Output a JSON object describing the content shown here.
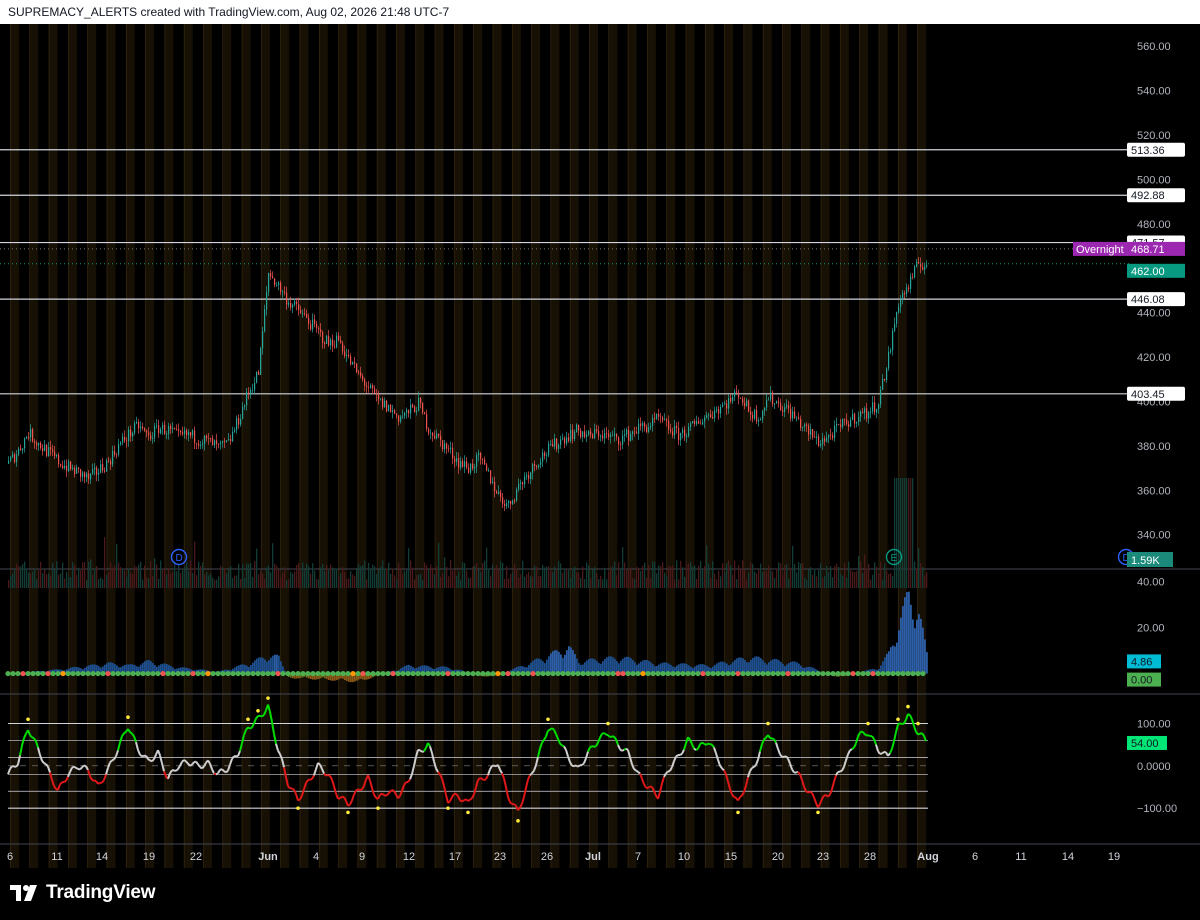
{
  "header": {
    "caption": "SUPREMACY_ALERTS created with TradingView.com, Aug 02, 2026 21:48 UTC-7"
  },
  "footer": {
    "brand": "TradingView"
  },
  "colors": {
    "background": "#000000",
    "up_candle": "#26a69a",
    "down_candle": "#ef5350",
    "level_line": "#d1d4dc",
    "overnight_badge": "#9c27b0",
    "last_price_badge": "#089981",
    "volume_badge": "#1b8a7a",
    "momentum_value_badge": "#00bcd4",
    "momentum_zero_badge": "#4caf50",
    "cci_value_badge": "#00e676",
    "cci_up": "#00e000",
    "cci_down": "#e01818",
    "cci_neutral": "#cfcfcf",
    "dots": "#ffeb3b"
  },
  "chart_data": [
    {
      "type": "candlestick",
      "pane": "price",
      "x_ticks": [
        "6",
        "11",
        "14",
        "19",
        "22",
        "Jun",
        "4",
        "9",
        "12",
        "17",
        "23",
        "26",
        "Jul",
        "7",
        "10",
        "15",
        "20",
        "23",
        "28",
        "Aug",
        "6",
        "11",
        "14",
        "19"
      ],
      "y_ticks": [
        "560.00",
        "540.00",
        "520.00",
        "500.00",
        "480.00",
        "440.00",
        "420.00",
        "400.00",
        "380.00",
        "360.00",
        "340.00"
      ],
      "ylim": [
        325,
        570
      ],
      "path_key": [
        [
          0,
          372
        ],
        [
          1,
          378
        ],
        [
          2,
          386
        ],
        [
          3,
          381
        ],
        [
          4,
          377
        ],
        [
          5,
          373
        ],
        [
          6,
          370
        ],
        [
          7,
          368
        ],
        [
          8,
          365
        ],
        [
          9,
          369
        ],
        [
          10,
          373
        ],
        [
          11,
          380
        ],
        [
          12,
          385
        ],
        [
          13,
          389
        ],
        [
          14,
          384
        ],
        [
          15,
          388
        ],
        [
          16,
          387
        ],
        [
          17,
          384
        ],
        [
          18,
          385
        ],
        [
          19,
          383
        ],
        [
          20,
          382
        ],
        [
          21,
          379
        ],
        [
          22,
          381
        ],
        [
          23,
          392
        ],
        [
          24,
          404
        ],
        [
          25,
          413
        ],
        [
          26,
          458
        ],
        [
          27,
          452
        ],
        [
          28,
          445
        ],
        [
          29,
          441
        ],
        [
          30,
          436
        ],
        [
          31,
          431
        ],
        [
          32,
          426
        ],
        [
          33,
          428
        ],
        [
          34,
          419
        ],
        [
          35,
          412
        ],
        [
          36,
          406
        ],
        [
          37,
          400
        ],
        [
          38,
          397
        ],
        [
          39,
          393
        ],
        [
          40,
          395
        ],
        [
          41,
          399
        ],
        [
          42,
          388
        ],
        [
          43,
          383
        ],
        [
          44,
          378
        ],
        [
          45,
          373
        ],
        [
          46,
          370
        ],
        [
          47,
          374
        ],
        [
          48,
          367
        ],
        [
          49,
          358
        ],
        [
          50,
          353
        ],
        [
          51,
          362
        ],
        [
          52,
          368
        ],
        [
          53,
          374
        ],
        [
          54,
          378
        ],
        [
          55,
          382
        ],
        [
          56,
          385
        ],
        [
          57,
          387
        ],
        [
          58,
          384
        ],
        [
          59,
          386
        ],
        [
          60,
          384
        ],
        [
          61,
          383
        ],
        [
          62,
          385
        ],
        [
          63,
          388
        ],
        [
          64,
          389
        ],
        [
          65,
          392
        ],
        [
          66,
          388
        ],
        [
          67,
          385
        ],
        [
          68,
          387
        ],
        [
          69,
          391
        ],
        [
          70,
          394
        ],
        [
          71,
          397
        ],
        [
          72,
          400
        ],
        [
          73,
          404
        ],
        [
          74,
          396
        ],
        [
          75,
          393
        ],
        [
          76,
          402
        ],
        [
          77,
          399
        ],
        [
          78,
          396
        ],
        [
          79,
          391
        ],
        [
          80,
          386
        ],
        [
          81,
          382
        ],
        [
          82,
          384
        ],
        [
          83,
          388
        ],
        [
          84,
          391
        ],
        [
          85,
          394
        ],
        [
          86,
          395
        ],
        [
          87,
          400
        ],
        [
          88,
          420
        ],
        [
          89,
          445
        ],
        [
          90,
          452
        ],
        [
          91,
          462
        ],
        [
          92,
          462
        ]
      ],
      "levels": [
        {
          "label": "513.36",
          "value": 513.36
        },
        {
          "label": "492.88",
          "value": 492.88
        },
        {
          "label": "471.57",
          "value": 471.57
        },
        {
          "label": "446.08",
          "value": 446.08
        },
        {
          "label": "403.45",
          "value": 403.45
        }
      ],
      "overnight": {
        "label": "Overnight",
        "value_label": "468.71",
        "value": 468.71
      },
      "last_price": {
        "label": "462.00",
        "value": 462.0
      },
      "volume_badge": "1.59K",
      "event_markers": [
        {
          "text": "D",
          "kind": "dividend"
        },
        {
          "text": "E",
          "kind": "earnings"
        },
        {
          "text": "D",
          "kind": "dividend"
        }
      ]
    },
    {
      "type": "histogram",
      "pane": "momentum",
      "y_ticks": [
        "40.00",
        "20.00"
      ],
      "ylim": [
        -8,
        45
      ],
      "current_value": "4.86",
      "zero_label": "0.00",
      "peaks": [
        [
          0,
          0
        ],
        [
          5,
          2
        ],
        [
          10,
          5
        ],
        [
          12,
          4
        ],
        [
          14,
          6
        ],
        [
          17,
          3
        ],
        [
          21,
          1
        ],
        [
          24,
          5
        ],
        [
          26,
          9
        ],
        [
          27,
          8
        ],
        [
          28,
          -2
        ],
        [
          32,
          -3
        ],
        [
          35,
          -4
        ],
        [
          40,
          4
        ],
        [
          44,
          3
        ],
        [
          48,
          -2
        ],
        [
          52,
          5
        ],
        [
          56,
          13
        ],
        [
          57,
          6
        ],
        [
          61,
          8
        ],
        [
          65,
          5
        ],
        [
          70,
          4
        ],
        [
          74,
          8
        ],
        [
          79,
          5
        ],
        [
          83,
          -2
        ],
        [
          87,
          3
        ],
        [
          88,
          10
        ],
        [
          90,
          39
        ],
        [
          91,
          30
        ],
        [
          92,
          5
        ]
      ]
    },
    {
      "type": "line",
      "pane": "cci",
      "y_ticks": [
        "100.00",
        "0.0000",
        "−100.00"
      ],
      "ylim": [
        -180,
        165
      ],
      "current_value": "54.00",
      "band_levels": [
        100,
        60,
        20,
        0,
        -20,
        -60,
        -100
      ],
      "values": [
        [
          0,
          -20
        ],
        [
          1,
          10
        ],
        [
          2,
          90
        ],
        [
          3,
          40
        ],
        [
          4,
          -10
        ],
        [
          5,
          -60
        ],
        [
          6,
          -20
        ],
        [
          7,
          0
        ],
        [
          8,
          -10
        ],
        [
          9,
          -50
        ],
        [
          10,
          -10
        ],
        [
          11,
          40
        ],
        [
          12,
          95
        ],
        [
          13,
          40
        ],
        [
          14,
          10
        ],
        [
          15,
          30
        ],
        [
          16,
          -30
        ],
        [
          17,
          0
        ],
        [
          18,
          10
        ],
        [
          19,
          0
        ],
        [
          20,
          5
        ],
        [
          21,
          -20
        ],
        [
          22,
          -5
        ],
        [
          23,
          30
        ],
        [
          24,
          90
        ],
        [
          25,
          110
        ],
        [
          26,
          140
        ],
        [
          27,
          40
        ],
        [
          28,
          -40
        ],
        [
          29,
          -80
        ],
        [
          30,
          -40
        ],
        [
          31,
          0
        ],
        [
          32,
          -20
        ],
        [
          33,
          -70
        ],
        [
          34,
          -90
        ],
        [
          35,
          -60
        ],
        [
          36,
          -30
        ],
        [
          37,
          -80
        ],
        [
          38,
          -60
        ],
        [
          39,
          -70
        ],
        [
          40,
          -40
        ],
        [
          41,
          30
        ],
        [
          42,
          50
        ],
        [
          43,
          -10
        ],
        [
          44,
          -80
        ],
        [
          45,
          -70
        ],
        [
          46,
          -90
        ],
        [
          47,
          -40
        ],
        [
          48,
          -20
        ],
        [
          49,
          10
        ],
        [
          50,
          -70
        ],
        [
          51,
          -110
        ],
        [
          52,
          -40
        ],
        [
          53,
          20
        ],
        [
          54,
          90
        ],
        [
          55,
          70
        ],
        [
          56,
          20
        ],
        [
          57,
          -10
        ],
        [
          58,
          30
        ],
        [
          59,
          60
        ],
        [
          60,
          80
        ],
        [
          61,
          50
        ],
        [
          62,
          30
        ],
        [
          63,
          -20
        ],
        [
          64,
          -50
        ],
        [
          65,
          -70
        ],
        [
          66,
          -10
        ],
        [
          67,
          20
        ],
        [
          68,
          60
        ],
        [
          69,
          40
        ],
        [
          70,
          60
        ],
        [
          71,
          20
        ],
        [
          72,
          -40
        ],
        [
          73,
          -90
        ],
        [
          74,
          -30
        ],
        [
          75,
          20
        ],
        [
          76,
          80
        ],
        [
          77,
          40
        ],
        [
          78,
          10
        ],
        [
          79,
          -20
        ],
        [
          80,
          -60
        ],
        [
          81,
          -90
        ],
        [
          82,
          -70
        ],
        [
          83,
          -20
        ],
        [
          84,
          20
        ],
        [
          85,
          70
        ],
        [
          86,
          80
        ],
        [
          87,
          40
        ],
        [
          88,
          20
        ],
        [
          89,
          90
        ],
        [
          90,
          120
        ],
        [
          91,
          80
        ],
        [
          92,
          54
        ]
      ]
    }
  ]
}
